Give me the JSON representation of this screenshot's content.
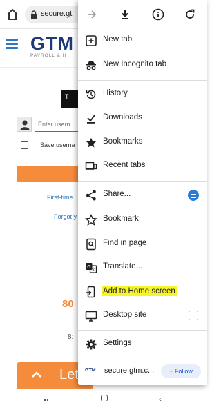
{
  "address_bar": {
    "url": "secure.gt",
    "home_icon": "home-icon",
    "lock_icon": "lock-icon"
  },
  "site": {
    "logo": "GTM",
    "logo_sub": "PAYROLL & H",
    "tab_label": "T",
    "username_placeholder": "Enter usern",
    "save_username": "Save userna",
    "first_time_link": "First-time",
    "forgot_link": "Forgot y",
    "phone_fragment": "80",
    "hours_fragment": "8:",
    "lets_fragment": "Let",
    "accent_color": "#f58c3c",
    "brand_color": "#1e3a78"
  },
  "menu": {
    "top_icons": [
      "forward-icon",
      "download-icon",
      "info-icon",
      "reload-icon"
    ],
    "items": [
      {
        "label": "New tab",
        "icon": "new-tab-icon"
      },
      {
        "label": "New Incognito tab",
        "icon": "incognito-icon"
      },
      {
        "label": "History",
        "icon": "history-icon"
      },
      {
        "label": "Downloads",
        "icon": "downloads-icon"
      },
      {
        "label": "Bookmarks",
        "icon": "bookmarks-star-icon"
      },
      {
        "label": "Recent tabs",
        "icon": "recent-tabs-icon"
      },
      {
        "label": "Share...",
        "icon": "share-icon"
      },
      {
        "label": "Bookmark",
        "icon": "bookmark-outline-star-icon"
      },
      {
        "label": "Find in page",
        "icon": "find-in-page-icon"
      },
      {
        "label": "Translate...",
        "icon": "translate-icon"
      },
      {
        "label": "Add to Home screen",
        "icon": "add-to-home-icon",
        "highlighted": true
      },
      {
        "label": "Desktop site",
        "icon": "desktop-icon",
        "checked": false
      },
      {
        "label": "Settings",
        "icon": "settings-gear-icon"
      }
    ],
    "footer": {
      "badge": "GTM",
      "site_name": "secure.gtm.c...",
      "follow_label": "+ Follow"
    },
    "highlight_color": "#f5f52a"
  }
}
